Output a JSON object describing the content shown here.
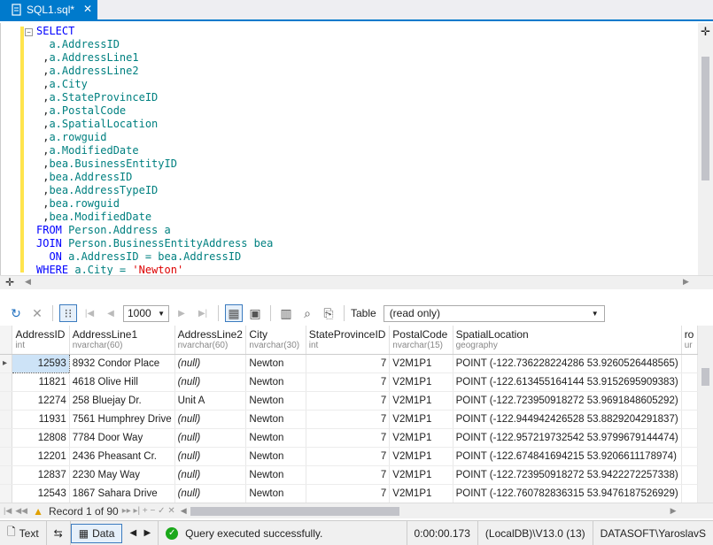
{
  "tab": {
    "title": "SQL1.sql*",
    "close": "✕"
  },
  "editor": {
    "lines": [
      [
        {
          "t": "SELECT",
          "c": "kw"
        }
      ],
      [
        {
          "t": "  a.AddressID",
          "c": "id"
        }
      ],
      [
        {
          "t": " ,",
          "c": "pl"
        },
        {
          "t": "a.AddressLine1",
          "c": "id"
        }
      ],
      [
        {
          "t": " ,",
          "c": "pl"
        },
        {
          "t": "a.AddressLine2",
          "c": "id"
        }
      ],
      [
        {
          "t": " ,",
          "c": "pl"
        },
        {
          "t": "a.City",
          "c": "id"
        }
      ],
      [
        {
          "t": " ,",
          "c": "pl"
        },
        {
          "t": "a.StateProvinceID",
          "c": "id"
        }
      ],
      [
        {
          "t": " ,",
          "c": "pl"
        },
        {
          "t": "a.PostalCode",
          "c": "id"
        }
      ],
      [
        {
          "t": " ,",
          "c": "pl"
        },
        {
          "t": "a.SpatialLocation",
          "c": "id"
        }
      ],
      [
        {
          "t": " ,",
          "c": "pl"
        },
        {
          "t": "a.rowguid",
          "c": "id"
        }
      ],
      [
        {
          "t": " ,",
          "c": "pl"
        },
        {
          "t": "a.ModifiedDate",
          "c": "id"
        }
      ],
      [
        {
          "t": " ,",
          "c": "pl"
        },
        {
          "t": "bea.BusinessEntityID",
          "c": "id"
        }
      ],
      [
        {
          "t": " ,",
          "c": "pl"
        },
        {
          "t": "bea.AddressID",
          "c": "id"
        }
      ],
      [
        {
          "t": " ,",
          "c": "pl"
        },
        {
          "t": "bea.AddressTypeID",
          "c": "id"
        }
      ],
      [
        {
          "t": " ,",
          "c": "pl"
        },
        {
          "t": "bea.rowguid",
          "c": "id"
        }
      ],
      [
        {
          "t": " ,",
          "c": "pl"
        },
        {
          "t": "bea.ModifiedDate",
          "c": "id"
        }
      ],
      [
        {
          "t": "FROM ",
          "c": "kw"
        },
        {
          "t": "Person.Address a",
          "c": "id"
        }
      ],
      [
        {
          "t": "JOIN ",
          "c": "kw"
        },
        {
          "t": "Person.BusinessEntityAddress bea",
          "c": "id"
        }
      ],
      [
        {
          "t": "  ON ",
          "c": "kw"
        },
        {
          "t": "a.AddressID = bea.AddressID",
          "c": "id"
        }
      ],
      [
        {
          "t": "WHERE ",
          "c": "kw"
        },
        {
          "t": "a.City = ",
          "c": "id"
        },
        {
          "t": "'Newton'",
          "c": "str"
        }
      ]
    ]
  },
  "toolbar": {
    "page_size": "1000",
    "table_label": "Table",
    "table_value": "(read only)"
  },
  "grid": {
    "columns": [
      {
        "name": "AddressID",
        "type": "int",
        "w": 68
      },
      {
        "name": "AddressLine1",
        "type": "nvarchar(60)",
        "w": 117
      },
      {
        "name": "AddressLine2",
        "type": "nvarchar(60)",
        "w": 82
      },
      {
        "name": "City",
        "type": "nvarchar(30)",
        "w": 78
      },
      {
        "name": "StateProvinceID",
        "type": "int",
        "w": 97
      },
      {
        "name": "PostalCode",
        "type": "nvarchar(15)",
        "w": 78
      },
      {
        "name": "SpatialLocation",
        "type": "geography",
        "w": 246
      },
      {
        "name": "ro",
        "type": "ur",
        "w": 20
      }
    ],
    "rows": [
      [
        "12593",
        "8932 Condor Place",
        "(null)",
        "Newton",
        "7",
        "V2M1P1",
        "POINT (-122.736228224286 53.9260526448565)"
      ],
      [
        "11821",
        "4618 Olive Hill",
        "(null)",
        "Newton",
        "7",
        "V2M1P1",
        "POINT (-122.613455164144 53.9152695909383)"
      ],
      [
        "12274",
        "258 Bluejay Dr.",
        "Unit A",
        "Newton",
        "7",
        "V2M1P1",
        "POINT (-122.723950918272 53.9691848605292)"
      ],
      [
        "11931",
        "7561 Humphrey Drive",
        "(null)",
        "Newton",
        "7",
        "V2M1P1",
        "POINT (-122.944942426528 53.8829204291837)"
      ],
      [
        "12808",
        "7784 Door Way",
        "(null)",
        "Newton",
        "7",
        "V2M1P1",
        "POINT (-122.957219732542 53.9799679144474)"
      ],
      [
        "12201",
        "2436 Pheasant Cr.",
        "(null)",
        "Newton",
        "7",
        "V2M1P1",
        "POINT (-122.674841694215 53.9206611178974)"
      ],
      [
        "12837",
        "2230 May Way",
        "(null)",
        "Newton",
        "7",
        "V2M1P1",
        "POINT (-122.723950918272 53.9422272257338)"
      ],
      [
        "12543",
        "1867 Sahara Drive",
        "(null)",
        "Newton",
        "7",
        "V2M1P1",
        "POINT (-122.760782836315 53.9476187526929)"
      ]
    ]
  },
  "nav": {
    "record": "Record 1 of 90"
  },
  "status": {
    "text_tab": "Text",
    "data_tab": "Data",
    "message": "Query executed successfully.",
    "duration": "0:00:00.173",
    "server": "(LocalDB)\\V13.0 (13)",
    "user": "DATASOFT\\YaroslavS"
  }
}
